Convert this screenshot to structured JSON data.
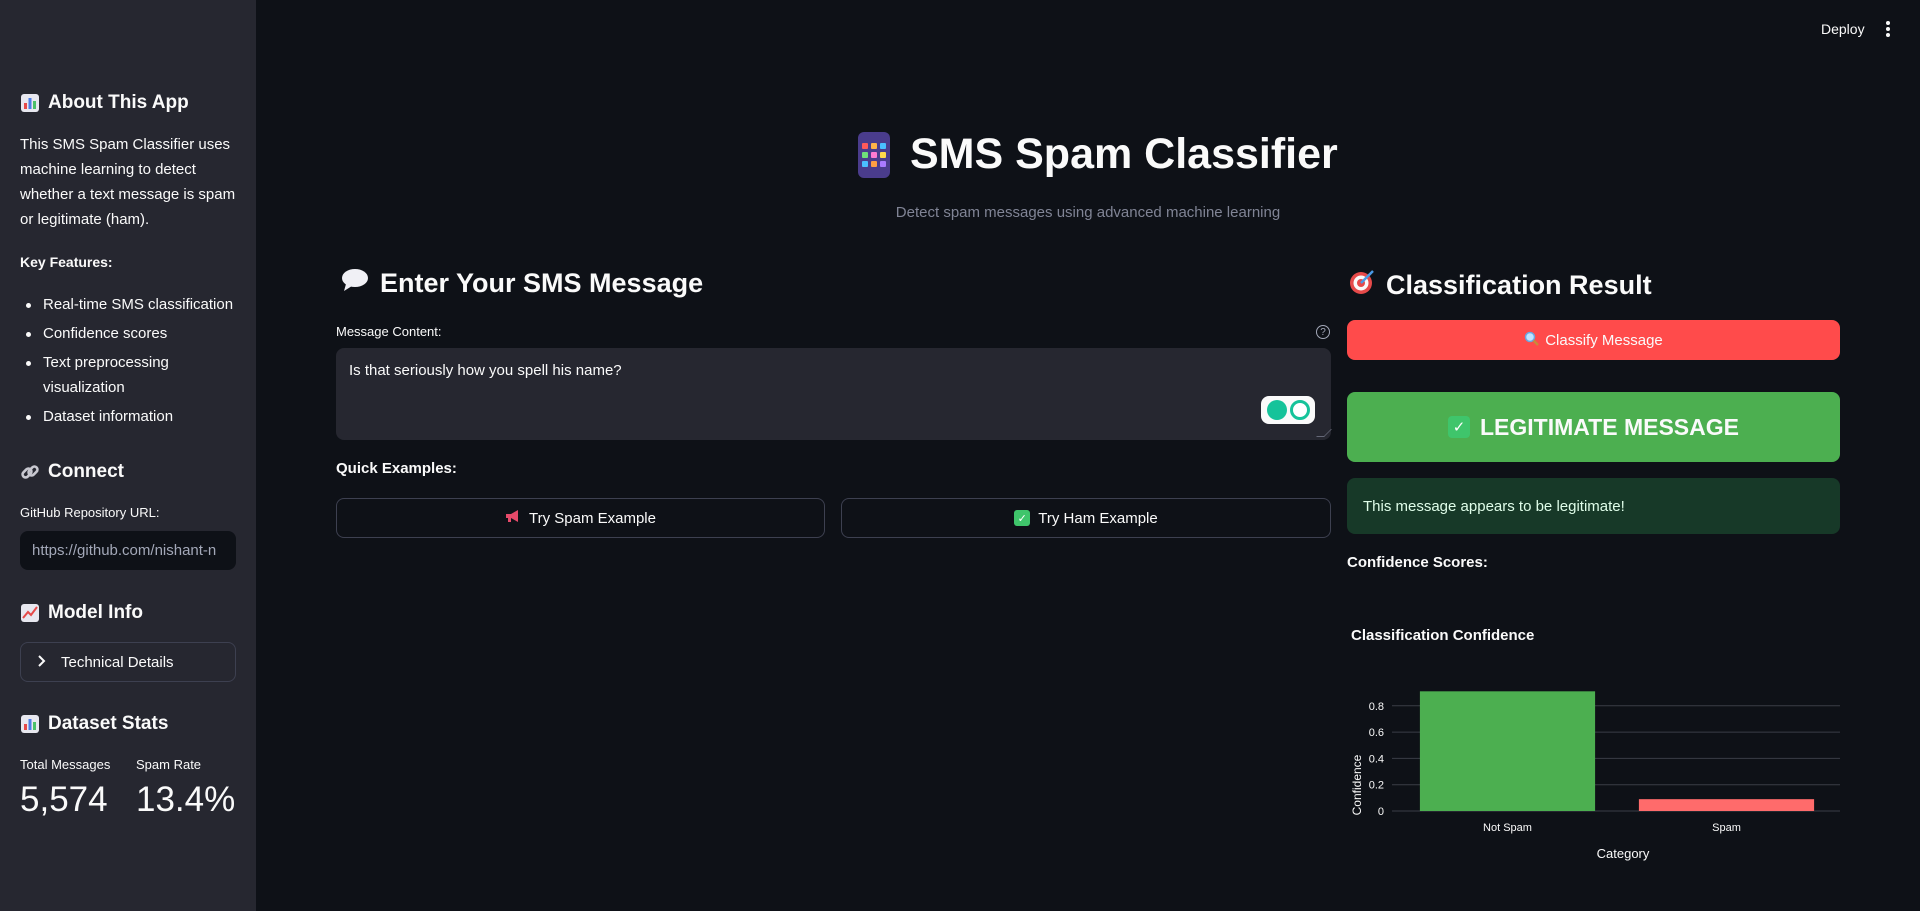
{
  "sidebar": {
    "about": {
      "icon": "bar-chart-icon",
      "title": "About This App"
    },
    "description": "This SMS Spam Classifier uses machine learning to detect whether a text message is spam or legitimate (ham).",
    "key_features_label": "Key Features:",
    "features": [
      "Real-time SMS classification",
      "Confidence scores",
      "Text preprocessing visualization",
      "Dataset information"
    ],
    "connect": {
      "icon": "link-icon",
      "title": "Connect"
    },
    "github_label": "GitHub Repository URL:",
    "github_placeholder": "https://github.com/nishant-n",
    "model_info": {
      "icon": "trend-chart-icon",
      "title": "Model Info"
    },
    "technical_details": "Technical Details",
    "dataset_stats": {
      "icon": "bar-chart-icon",
      "title": "Dataset Stats"
    },
    "metrics": [
      {
        "label": "Total Messages",
        "value": "5,574"
      },
      {
        "label": "Spam Rate",
        "value": "13.4%"
      }
    ]
  },
  "header": {
    "deploy_label": "Deploy"
  },
  "main": {
    "title": "SMS Spam Classifier",
    "subtitle": "Detect spam messages using advanced machine learning",
    "input_section": {
      "title": "Enter Your SMS Message",
      "icon": "speech-bubble-icon"
    },
    "message_label": "Message Content:",
    "message_value": "Is that seriously how you spell his name?",
    "quick_examples_label": "Quick Examples:",
    "spam_example_label": "Try Spam Example",
    "ham_example_label": "Try Ham Example",
    "result_section": {
      "title": "Classification Result",
      "icon": "target-icon"
    },
    "classify_label": "Classify Message",
    "result_label": "LEGITIMATE MESSAGE",
    "result_message": "This message appears to be legitimate!",
    "confidence_label": "Confidence Scores:"
  },
  "colors": {
    "primary": "#ff4b4b",
    "legit": "#4caf50",
    "spam_bar": "#ff6b6b",
    "sidebar_bg": "#262730",
    "app_bg": "#0e1117"
  },
  "chart_data": {
    "type": "bar",
    "title": "Classification Confidence",
    "xlabel": "Category",
    "ylabel": "Confidence",
    "categories": [
      "Not Spam",
      "Spam"
    ],
    "values": [
      0.91,
      0.09
    ],
    "colors": [
      "#4caf50",
      "#ff6b6b"
    ],
    "ylim": [
      0,
      0.92
    ],
    "yticks": [
      0,
      0.2,
      0.4,
      0.6,
      0.8
    ],
    "grid": true
  }
}
